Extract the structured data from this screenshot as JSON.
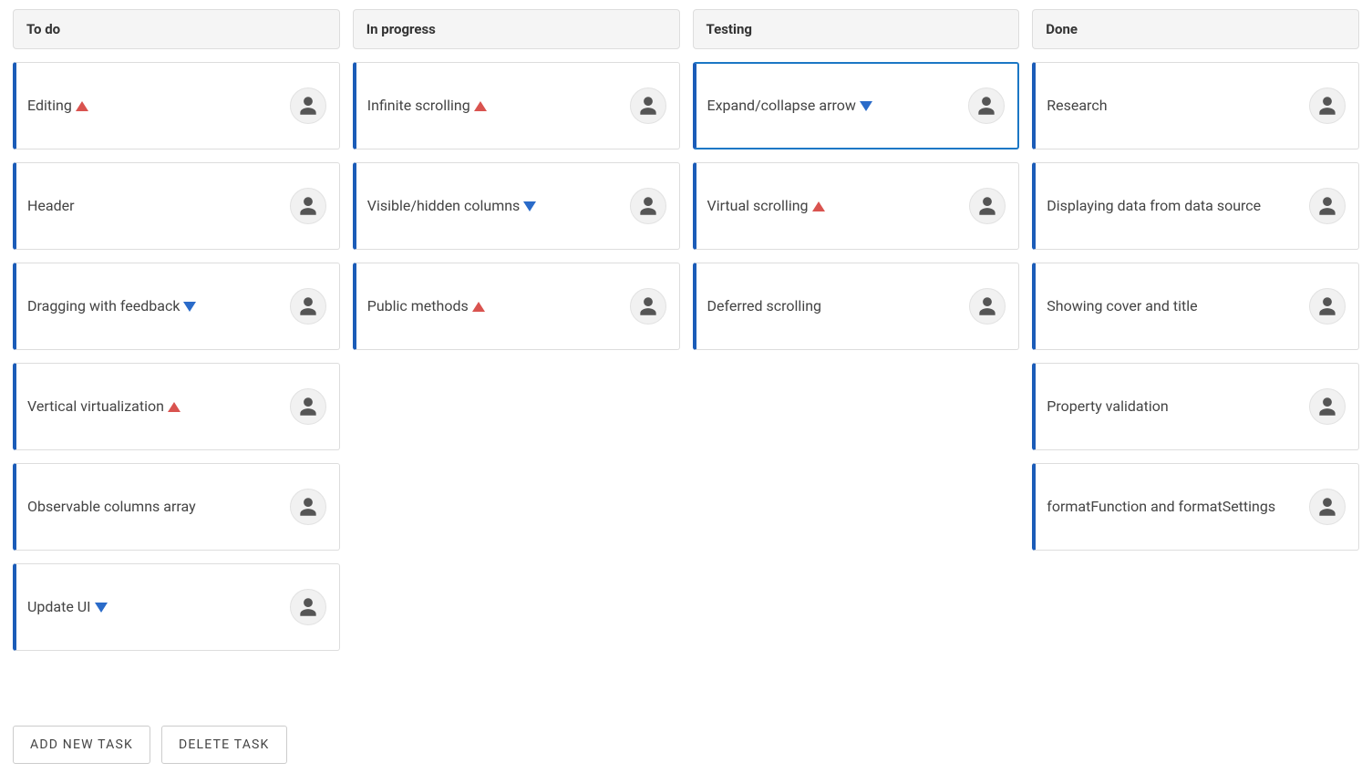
{
  "columns": [
    {
      "title": "To do",
      "cards": [
        {
          "title": "Editing",
          "priority": "up",
          "selected": false
        },
        {
          "title": "Header",
          "priority": null,
          "selected": false
        },
        {
          "title": "Dragging with feedback",
          "priority": "down",
          "selected": false
        },
        {
          "title": "Vertical virtualization",
          "priority": "up",
          "selected": false
        },
        {
          "title": "Observable columns array",
          "priority": null,
          "selected": false
        },
        {
          "title": "Update UI",
          "priority": "down",
          "selected": false
        }
      ]
    },
    {
      "title": "In progress",
      "cards": [
        {
          "title": "Infinite scrolling",
          "priority": "up",
          "selected": false
        },
        {
          "title": "Visible/hidden columns",
          "priority": "down",
          "selected": false
        },
        {
          "title": "Public methods",
          "priority": "up",
          "selected": false
        }
      ]
    },
    {
      "title": "Testing",
      "cards": [
        {
          "title": "Expand/collapse arrow",
          "priority": "down",
          "selected": true
        },
        {
          "title": "Virtual scrolling",
          "priority": "up",
          "selected": false
        },
        {
          "title": "Deferred scrolling",
          "priority": null,
          "selected": false
        }
      ]
    },
    {
      "title": "Done",
      "cards": [
        {
          "title": "Research",
          "priority": null,
          "selected": false
        },
        {
          "title": "Displaying data from data source",
          "priority": null,
          "selected": false
        },
        {
          "title": "Showing cover and title",
          "priority": null,
          "selected": false
        },
        {
          "title": "Property validation",
          "priority": null,
          "selected": false
        },
        {
          "title": "formatFunction and formatSettings",
          "priority": null,
          "selected": false
        }
      ]
    }
  ],
  "buttons": {
    "add": "ADD NEW TASK",
    "delete": "DELETE TASK"
  }
}
